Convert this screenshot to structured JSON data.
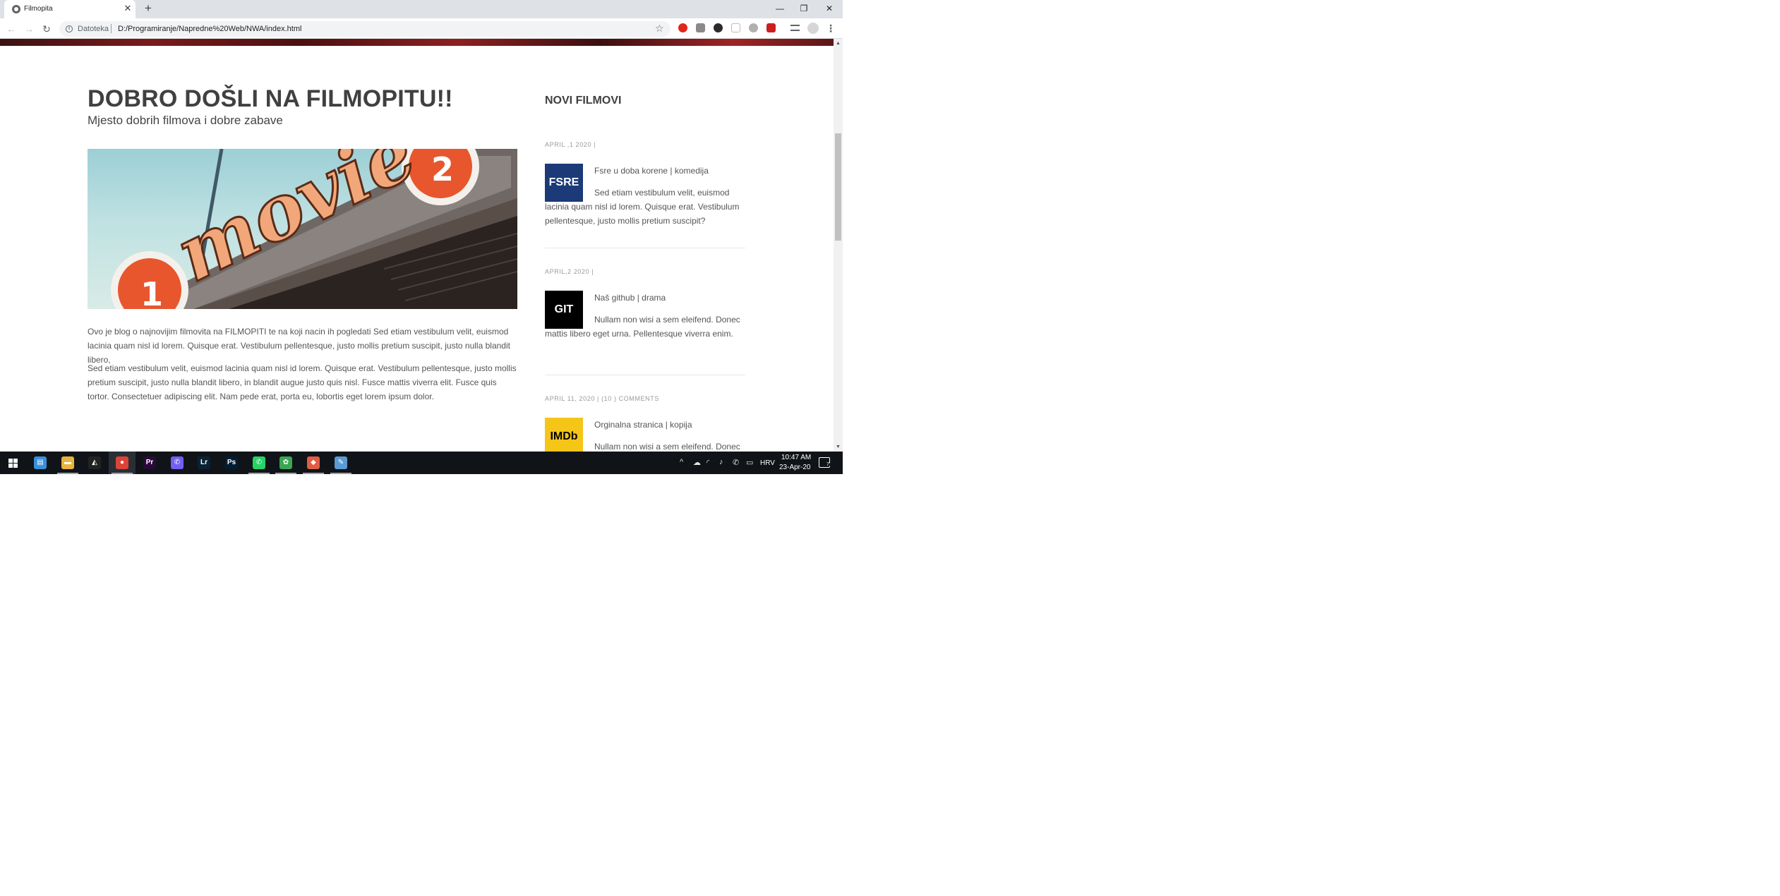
{
  "browser": {
    "tab_title": "Filmopita",
    "tab_close": "✕",
    "new_tab": "+",
    "window_minimize": "—",
    "window_restore": "❐",
    "window_close": "✕",
    "back": "←",
    "forward": "→",
    "reload": "↻",
    "url_scheme": "Datoteka",
    "url": "D:/Programiranje/Napredne%20Web/NWA/index.html",
    "star": "☆",
    "menu": "⋮",
    "extensions": [
      "opera-extension-icon",
      "pdf-extension-icon",
      "media-extension-icon",
      "reader-extension-icon",
      "shield-extension-icon",
      "video-extension-icon",
      "media-control-icon",
      "profile-avatar-icon"
    ]
  },
  "page": {
    "title": "DOBRO DOŠLI NA FILMOPITU!!",
    "subtitle": "Mjesto dobrih filmova i dobre zabave",
    "hero_sign_text": "movie",
    "hero_left_number": "1",
    "hero_right_number": "2",
    "paragraphs": [
      "Ovo je blog o najnovijim filmovita na FILMOPITI te na koji nacin ih pogledati Sed etiam vestibulum velit, euismod lacinia quam nisl id lorem. Quisque erat. Vestibulum pellentesque, justo mollis pretium suscipit, justo nulla blandit libero,",
      "Sed etiam vestibulum velit, euismod lacinia quam nisl id lorem. Quisque erat. Vestibulum pellentesque, justo mollis pretium suscipit, justo nulla blandit libero, in blandit augue justo quis nisl. Fusce mattis viverra elit. Fusce quis tortor. Consectetuer adipiscing elit. Nam pede erat, porta eu, lobortis eget lorem ipsum dolor."
    ]
  },
  "sidebar": {
    "heading": "NOVI FILMOVI",
    "posts": [
      {
        "meta": "APRIL ,1 2020 |",
        "thumb_text": "FSRE",
        "thumb_color": "#1c3a78",
        "thumb_text_color": "#ffffff",
        "title": "Fsre u doba korene | komedija",
        "text": "Sed etiam vestibulum velit, euismod lacinia quam nisl id lorem. Quisque erat. Vestibulum pellentesque, justo mollis pretium suscipit?"
      },
      {
        "meta": "APRIL,2 2020 |",
        "thumb_text": "GIT",
        "thumb_color": "#000000",
        "thumb_text_color": "#ffffff",
        "title": "Naš github | drama",
        "text": "Nullam non wisi a sem eleifend. Donec mattis libero eget urna. Pellentesque viverra enim."
      },
      {
        "meta": "APRIL 11, 2020 | (10 ) COMMENTS",
        "thumb_text": "IMDb",
        "thumb_color": "#f5c518",
        "thumb_text_color": "#000000",
        "title": "Orginalna stranica | kopija",
        "text": "Nullam non wisi a sem eleifend. Donec"
      }
    ]
  },
  "scrollbar": {
    "up": "▲",
    "down": "▼"
  },
  "taskbar": {
    "start": "start-button-icon",
    "apps": [
      {
        "name": "taskbar-explorer-desktop",
        "glyph": "▤",
        "color": "#3b8fd9",
        "active": false,
        "open": false
      },
      {
        "name": "taskbar-file-explorer",
        "glyph": "▬",
        "color": "#e8b33a",
        "active": false,
        "open": true
      },
      {
        "name": "taskbar-game-app",
        "glyph": "◭",
        "color": "#222222",
        "active": false,
        "open": false
      },
      {
        "name": "taskbar-chrome",
        "glyph": "●",
        "color": "#db4437",
        "active": true,
        "open": true
      },
      {
        "name": "taskbar-premiere",
        "glyph": "Pr",
        "color": "#2a0a3a",
        "active": false,
        "open": false
      },
      {
        "name": "taskbar-viber",
        "glyph": "✆",
        "color": "#7360f2",
        "active": false,
        "open": false
      },
      {
        "name": "taskbar-lightroom",
        "glyph": "Lr",
        "color": "#0a2233",
        "active": false,
        "open": false
      },
      {
        "name": "taskbar-photoshop",
        "glyph": "Ps",
        "color": "#001d34",
        "active": false,
        "open": false
      },
      {
        "name": "taskbar-whatsapp",
        "glyph": "✆",
        "color": "#25d366",
        "active": false,
        "open": true
      },
      {
        "name": "taskbar-app-green",
        "glyph": "✿",
        "color": "#3aa655",
        "active": false,
        "open": true
      },
      {
        "name": "taskbar-git-app",
        "glyph": "◆",
        "color": "#e05d44",
        "active": false,
        "open": true
      },
      {
        "name": "taskbar-paint-app",
        "glyph": "✎",
        "color": "#5b9bd5",
        "active": false,
        "open": true
      }
    ],
    "tray_chevron": "^",
    "language": "HRV",
    "time": "10:47 AM",
    "date": "23-Apr-20",
    "notifications": "7"
  }
}
